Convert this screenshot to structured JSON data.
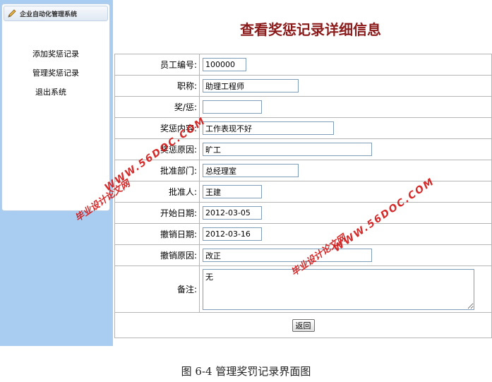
{
  "sidebar": {
    "header_title": "企业自动化管理系统",
    "items": [
      {
        "label": "添加奖惩记录"
      },
      {
        "label": "管理奖惩记录"
      },
      {
        "label": "退出系统"
      }
    ]
  },
  "main": {
    "title": "查看奖惩记录详细信息",
    "fields": {
      "employee_id": {
        "label": "员工编号:",
        "value": "100000"
      },
      "job_title": {
        "label": "职称:",
        "value": "助理工程师"
      },
      "reward_punish": {
        "label": "奖/惩:",
        "value": ""
      },
      "content": {
        "label": "奖惩内容:",
        "value": "工作表现不好"
      },
      "reason": {
        "label": "奖惩原因:",
        "value": "旷工"
      },
      "approve_dept": {
        "label": "批准部门:",
        "value": "总经理室"
      },
      "approver": {
        "label": "批准人:",
        "value": "王建"
      },
      "start_date": {
        "label": "开始日期:",
        "value": "2012-03-05"
      },
      "revoke_date": {
        "label": "撤销日期:",
        "value": "2012-03-16"
      },
      "revoke_reason": {
        "label": "撤销原因:",
        "value": "改正"
      },
      "remark": {
        "label": "备注:",
        "value": "无"
      }
    },
    "back_button": "返回"
  },
  "caption": "图 6-4  管理奖罚记录界面图",
  "watermarks": {
    "a_url": "WWW.56DOC.COM",
    "a_name": "毕业设计论文网",
    "b_url": "WWW.56DOC.COM",
    "b_name": "毕业设计论文网"
  }
}
